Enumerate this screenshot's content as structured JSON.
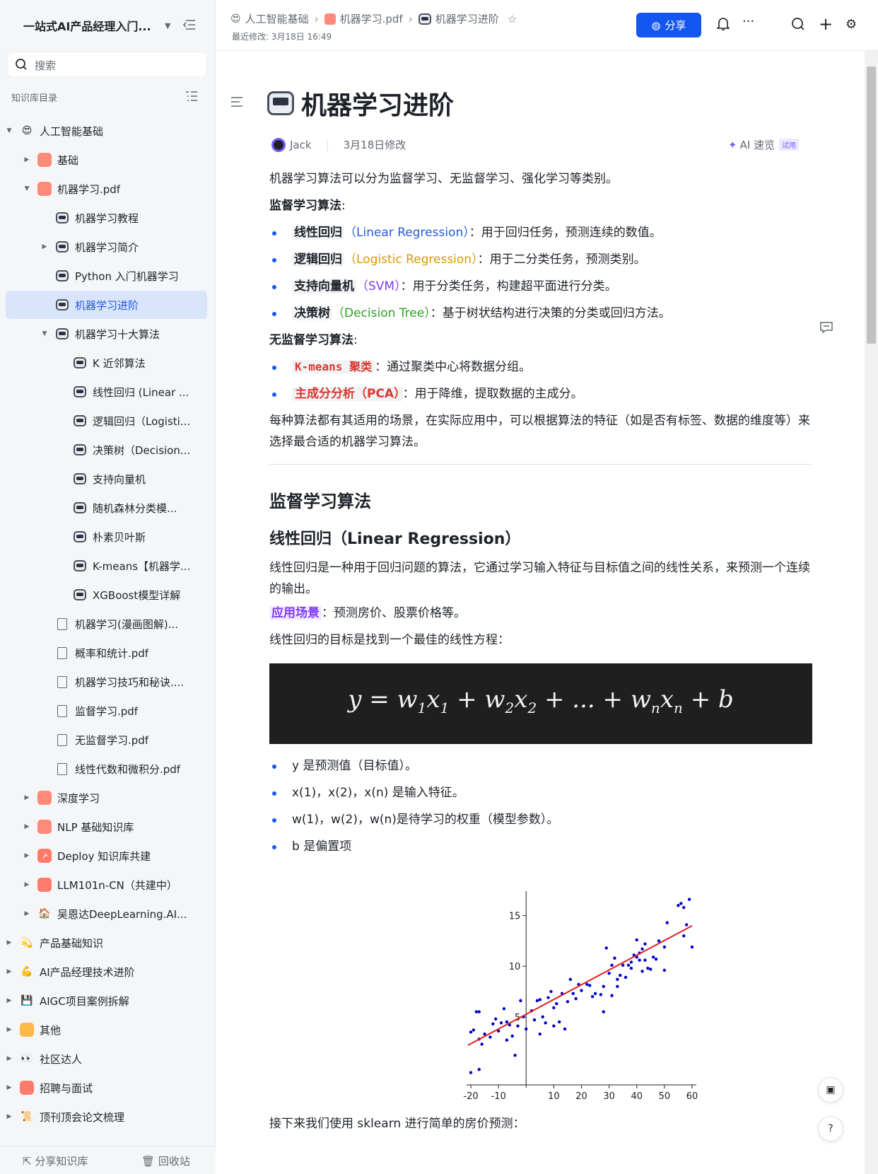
{
  "sidebar": {
    "title": "一站式AI产品经理入门...",
    "search_placeholder": "搜索",
    "catalog_label": "知识库目录",
    "tree": [
      {
        "label": "人工智能基础",
        "icon": "😍",
        "level": 0,
        "toggle": "open"
      },
      {
        "label": "基础",
        "icon": "book-icon",
        "level": 1,
        "toggle": "closed"
      },
      {
        "label": "机器学习.pdf",
        "icon": "book-icon",
        "level": 1,
        "toggle": "open"
      },
      {
        "label": "机器学习教程",
        "icon": "robot-icon",
        "level": 2,
        "toggle": "none"
      },
      {
        "label": "机器学习简介",
        "icon": "robot-icon",
        "level": 2,
        "toggle": "closed"
      },
      {
        "label": "Python 入门机器学习",
        "icon": "robot-icon",
        "level": 2,
        "toggle": "none"
      },
      {
        "label": "机器学习进阶",
        "icon": "robot-icon",
        "level": 2,
        "toggle": "none",
        "selected": true
      },
      {
        "label": "机器学习十大算法",
        "icon": "robot-icon",
        "level": 2,
        "toggle": "open"
      },
      {
        "label": "K 近邻算法",
        "icon": "robot-icon",
        "level": 3,
        "toggle": "none"
      },
      {
        "label": "线性回归 (Linear ...",
        "icon": "robot-icon",
        "level": 3,
        "toggle": "none"
      },
      {
        "label": "逻辑回归（Logisti...",
        "icon": "robot-icon",
        "level": 3,
        "toggle": "none"
      },
      {
        "label": "决策树（Decision...",
        "icon": "robot-icon",
        "level": 3,
        "toggle": "none"
      },
      {
        "label": "支持向量机",
        "icon": "robot-icon",
        "level": 3,
        "toggle": "none"
      },
      {
        "label": "随机森林分类模...",
        "icon": "robot-icon",
        "level": 3,
        "toggle": "none"
      },
      {
        "label": "朴素贝叶斯",
        "icon": "robot-icon",
        "level": 3,
        "toggle": "none"
      },
      {
        "label": "K-means【机器学...",
        "icon": "robot-icon",
        "level": 3,
        "toggle": "none"
      },
      {
        "label": "XGBoost模型详解",
        "icon": "robot-icon",
        "level": 3,
        "toggle": "none"
      },
      {
        "label": "机器学习(漫画图解)...",
        "icon": "pdf-icon",
        "level": 2,
        "toggle": "none"
      },
      {
        "label": "概率和统计.pdf",
        "icon": "pdf-icon",
        "level": 2,
        "toggle": "none"
      },
      {
        "label": "机器学习技巧和秘诀....",
        "icon": "pdf-icon",
        "level": 2,
        "toggle": "none"
      },
      {
        "label": "监督学习.pdf",
        "icon": "pdf-icon",
        "level": 2,
        "toggle": "none"
      },
      {
        "label": "无监督学习.pdf",
        "icon": "pdf-icon",
        "level": 2,
        "toggle": "none"
      },
      {
        "label": "线性代数和微积分.pdf",
        "icon": "pdf-icon",
        "level": 2,
        "toggle": "none"
      },
      {
        "label": "深度学习",
        "icon": "book-icon",
        "level": 1,
        "toggle": "closed"
      },
      {
        "label": "NLP 基础知识库",
        "icon": "book-icon",
        "level": 1,
        "toggle": "closed"
      },
      {
        "label": "Deploy 知识库共建",
        "icon": "chart-up-icon",
        "level": 1,
        "toggle": "closed"
      },
      {
        "label": "LLM101n-CN（共建中）",
        "icon": "monitor-icon",
        "level": 1,
        "toggle": "closed"
      },
      {
        "label": "吴恩达DeepLearning.AI...",
        "icon": "house-icon",
        "level": 1,
        "toggle": "closed"
      },
      {
        "label": "产品基础知识",
        "icon": "💫",
        "level": 0,
        "toggle": "closed"
      },
      {
        "label": "AI产品经理技术进阶",
        "icon": "💪",
        "level": 0,
        "toggle": "closed"
      },
      {
        "label": "AIGC项目案例拆解",
        "icon": "💾",
        "level": 0,
        "toggle": "closed"
      },
      {
        "label": "其他",
        "icon": "folder-icon",
        "level": 0,
        "toggle": "closed"
      },
      {
        "label": "社区达人",
        "icon": "👀",
        "level": 0,
        "toggle": "closed"
      },
      {
        "label": "招聘与面试",
        "icon": "mail-icon",
        "level": 0,
        "toggle": "closed"
      },
      {
        "label": "顶刊顶会论文梳理",
        "icon": "📜",
        "level": 0,
        "toggle": "closed"
      }
    ],
    "footer": {
      "share": "分享知识库",
      "trash": "回收站"
    }
  },
  "topbar": {
    "breadcrumb": [
      "人工智能基础",
      "机器学习.pdf",
      "机器学习进阶"
    ],
    "modified": "最近修改: 3月18日 16:49",
    "share_label": "分享"
  },
  "doc": {
    "title": "机器学习进阶",
    "author": "Jack",
    "edited": "3月18日修改",
    "ai_quick": "AI 速览",
    "ai_tag": "试用",
    "intro": "机器学习算法可以分为监督学习、无监督学习、强化学习等类别。",
    "supervised_label": "监督学习算法",
    "supervised": [
      {
        "name": "线性回归",
        "en": "（Linear Regression）",
        "desc": "：用于回归任务，预测连续的数值。"
      },
      {
        "name": "逻辑回归",
        "en": "（Logistic Regression）",
        "desc": "：用于二分类任务，预测类别。"
      },
      {
        "name": "支持向量机",
        "en": "（SVM）",
        "desc": "：用于分类任务，构建超平面进行分类。"
      },
      {
        "name": "决策树",
        "en": "（Decision Tree）",
        "desc": "：基于树状结构进行决策的分类或回归方法。"
      }
    ],
    "unsupervised_label": "无监督学习算法",
    "unsupervised": [
      {
        "name": "K-means 聚类",
        "desc": "：通过聚类中心将数据分组。"
      },
      {
        "name": "主成分分析（PCA）",
        "desc": "：用于降维，提取数据的主成分。"
      }
    ],
    "summary": "每种算法都有其适用的场景，在实际应用中，可以根据算法的特征（如是否有标签、数据的维度等）来选择最合适的机器学习算法。",
    "h2": "监督学习算法",
    "h3": "线性回归（Linear Regression）",
    "lr_desc": "线性回归是一种用于回归问题的算法，它通过学习输入特征与目标值之间的线性关系，来预测一个连续的输出。",
    "scene_label": "应用场景",
    "scene_text": "：预测房价、股票价格等。",
    "goal": "线性回归的目标是找到一个最佳的线性方程：",
    "formula": "y = w1x1 + w2x2 + ... + wnxn + b",
    "vars": [
      "y 是预测值（目标值）。",
      "x(1)，x(2)，x(n) 是输入特征。",
      "w(1)，w(2)，w(n)是待学习的权重（模型参数）。",
      "b 是偏置项"
    ],
    "next": "接下来我们使用 sklearn 进行简单的房价预测："
  },
  "chart_data": {
    "type": "scatter",
    "xlim": [
      -20,
      60
    ],
    "ylim": [
      -2,
      17
    ],
    "xticks": [
      -20,
      -10,
      10,
      20,
      30,
      40,
      50,
      60
    ],
    "yticks": [
      5,
      10,
      15
    ],
    "point_color": "#0000cc",
    "line_color": "#e02020",
    "fit_line": {
      "x": [
        -21,
        60
      ],
      "y": [
        2.2,
        14
      ]
    },
    "points": [
      [
        -20,
        3.5
      ],
      [
        -19,
        3.7
      ],
      [
        -18,
        5.5
      ],
      [
        -17,
        5.5
      ],
      [
        -17,
        2.8
      ],
      [
        -16,
        2.3
      ],
      [
        -15,
        3.3
      ],
      [
        -13,
        3.0
      ],
      [
        -12,
        4.3
      ],
      [
        -11,
        4.8
      ],
      [
        -10,
        3.6
      ],
      [
        -9,
        4.4
      ],
      [
        -8,
        5.8
      ],
      [
        -7,
        4.5
      ],
      [
        -7,
        2.7
      ],
      [
        -6,
        4.2
      ],
      [
        -5,
        3.1
      ],
      [
        -4,
        1.2
      ],
      [
        -3,
        4.1
      ],
      [
        -2,
        6.6
      ],
      [
        -1,
        5.0
      ],
      [
        0,
        3.8
      ],
      [
        2,
        5.6
      ],
      [
        3,
        4.7
      ],
      [
        4,
        6.6
      ],
      [
        5,
        6.7
      ],
      [
        5,
        3.3
      ],
      [
        6,
        5.0
      ],
      [
        7,
        4.4
      ],
      [
        8,
        6.9
      ],
      [
        9,
        7.5
      ],
      [
        10,
        5.9
      ],
      [
        10,
        4.1
      ],
      [
        11,
        6.3
      ],
      [
        12,
        4.5
      ],
      [
        13,
        7.3
      ],
      [
        14,
        3.8
      ],
      [
        15,
        6.5
      ],
      [
        16,
        8.7
      ],
      [
        17,
        7.3
      ],
      [
        18,
        6.8
      ],
      [
        19,
        8.2
      ],
      [
        20,
        7.6
      ],
      [
        22,
        8.2
      ],
      [
        23,
        8.1
      ],
      [
        24,
        7.0
      ],
      [
        25,
        7.3
      ],
      [
        27,
        7.2
      ],
      [
        28,
        8.0
      ],
      [
        28,
        5.5
      ],
      [
        29,
        11.8
      ],
      [
        30,
        9.3
      ],
      [
        31,
        10.1
      ],
      [
        31,
        7.1
      ],
      [
        32,
        10.8
      ],
      [
        33,
        8.7
      ],
      [
        33,
        8.0
      ],
      [
        34,
        9.1
      ],
      [
        35,
        10.1
      ],
      [
        36,
        8.9
      ],
      [
        37,
        10.1
      ],
      [
        38,
        10.4
      ],
      [
        38,
        9.8
      ],
      [
        39,
        11.1
      ],
      [
        40,
        10.9
      ],
      [
        40,
        12.6
      ],
      [
        41,
        10.6
      ],
      [
        41,
        11.3
      ],
      [
        42,
        9.5
      ],
      [
        42,
        11.7
      ],
      [
        43,
        10.6
      ],
      [
        43,
        12.2
      ],
      [
        44,
        9.8
      ],
      [
        45,
        9.7
      ],
      [
        46,
        10.9
      ],
      [
        47,
        10.7
      ],
      [
        48,
        12.5
      ],
      [
        50,
        11.9
      ],
      [
        50,
        9.6
      ],
      [
        51,
        14.3
      ],
      [
        55,
        16.0
      ],
      [
        56,
        16.2
      ],
      [
        57,
        13.0
      ],
      [
        57,
        15.8
      ],
      [
        58,
        14.1
      ],
      [
        59,
        16.6
      ],
      [
        60,
        11.9
      ],
      [
        -20,
        -0.5
      ],
      [
        -17,
        -0.2
      ]
    ]
  }
}
